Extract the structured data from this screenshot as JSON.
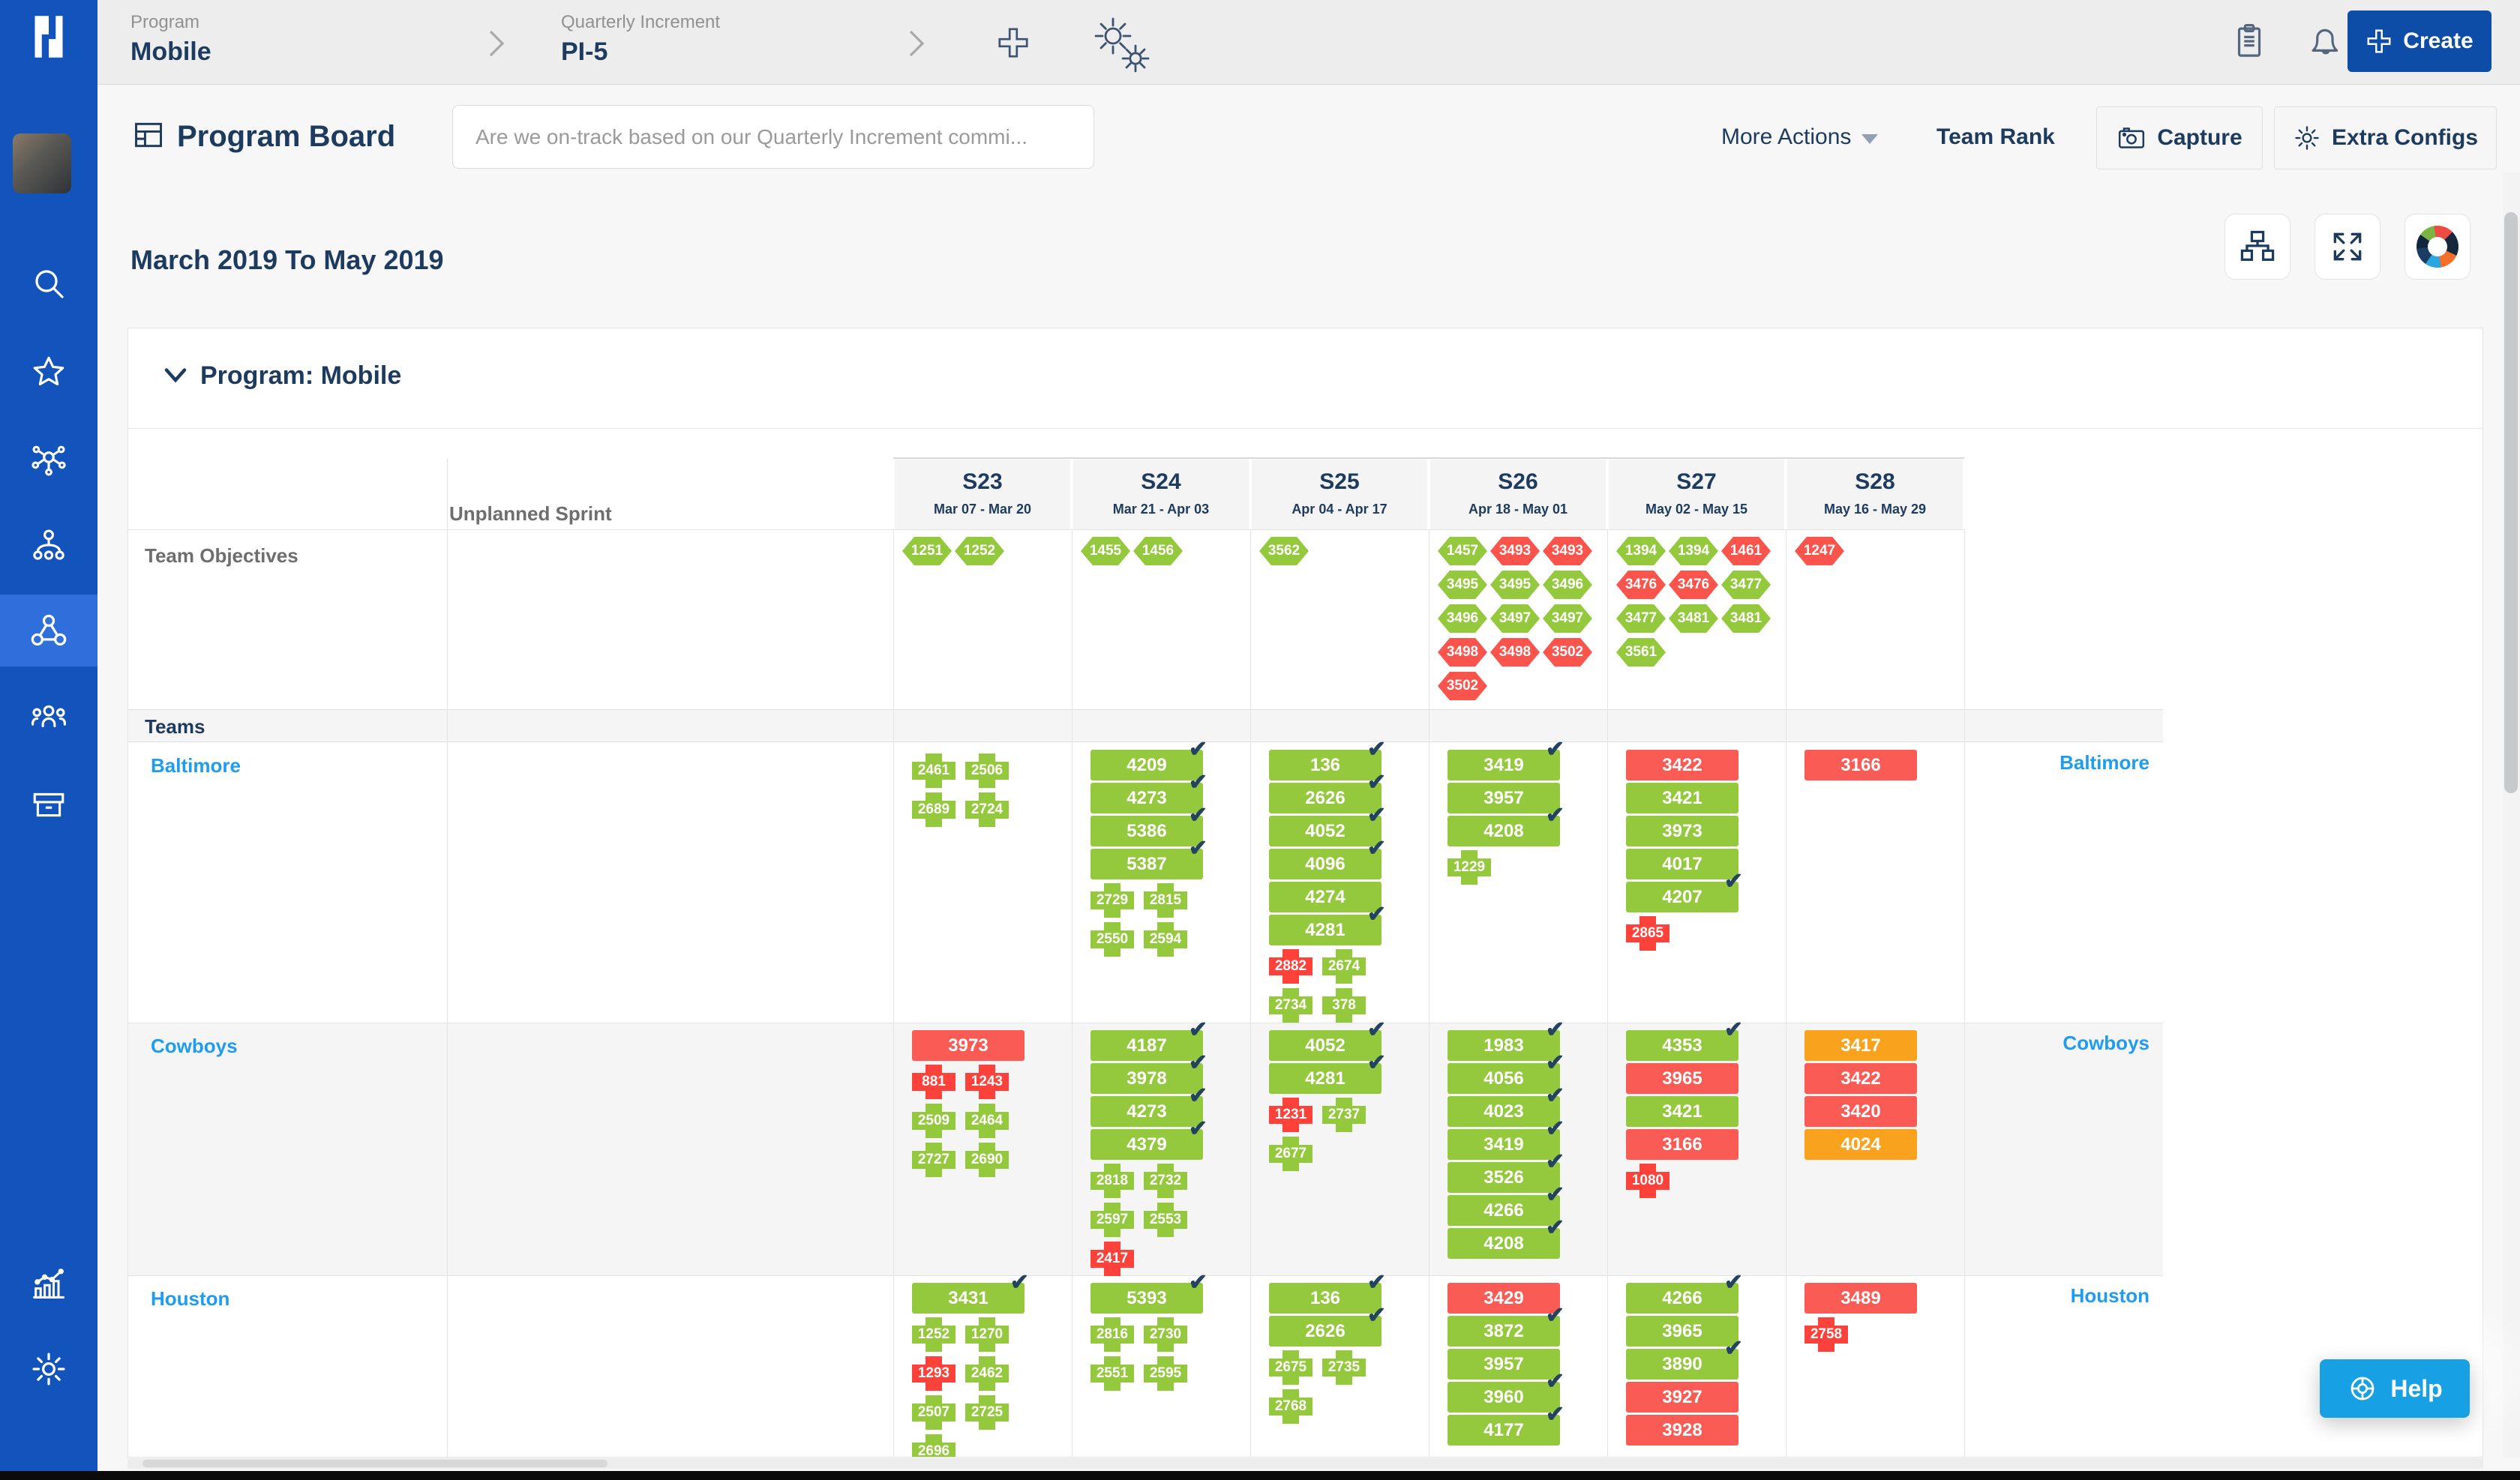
{
  "topbar": {
    "breadcrumbs": [
      {
        "label": "Program",
        "value": "Mobile"
      },
      {
        "label": "Quarterly Increment",
        "value": "PI-5"
      }
    ],
    "create_label": "Create"
  },
  "toolbar": {
    "title": "Program Board",
    "search_value": "Are we on-track based on our Quarterly Increment commi...",
    "more_actions_label": "More Actions",
    "team_rank_label": "Team Rank",
    "capture_label": "Capture",
    "extra_configs_label": "Extra Configs"
  },
  "board": {
    "date_range": "March 2019 To May 2019",
    "section_label": "Program: Mobile",
    "unplanned_sprint_label": "Unplanned Sprint",
    "team_objectives_label": "Team Objectives",
    "teams_label": "Teams",
    "sprints": [
      {
        "name": "S23",
        "dates": "Mar 07 - Mar 20"
      },
      {
        "name": "S24",
        "dates": "Mar 21 - Apr 03"
      },
      {
        "name": "S25",
        "dates": "Apr 04 - Apr 17"
      },
      {
        "name": "S26",
        "dates": "Apr 18 - May 01"
      },
      {
        "name": "S27",
        "dates": "May 02 - May 15"
      },
      {
        "name": "S28",
        "dates": "May 16 - May 29"
      }
    ],
    "objectives": [
      [
        [
          "1251",
          "green"
        ],
        [
          "1252",
          "green"
        ]
      ],
      [
        [
          "1455",
          "green"
        ],
        [
          "1456",
          "green"
        ]
      ],
      [
        [
          "3562",
          "green"
        ]
      ],
      [
        [
          "1457",
          "green"
        ],
        [
          "3493",
          "red"
        ],
        [
          "3493",
          "red"
        ],
        [
          "3495",
          "green"
        ],
        [
          "3495",
          "green"
        ],
        [
          "3496",
          "green"
        ],
        [
          "3496",
          "green"
        ],
        [
          "3497",
          "green"
        ],
        [
          "3497",
          "green"
        ],
        [
          "3498",
          "red"
        ],
        [
          "3498",
          "red"
        ],
        [
          "3502",
          "red"
        ],
        [
          "3502",
          "red"
        ]
      ],
      [
        [
          "1394",
          "green"
        ],
        [
          "1394",
          "green"
        ],
        [
          "1461",
          "red"
        ],
        [
          "3476",
          "red"
        ],
        [
          "3476",
          "red"
        ],
        [
          "3477",
          "green"
        ],
        [
          "3477",
          "green"
        ],
        [
          "3481",
          "green"
        ],
        [
          "3481",
          "green"
        ],
        [
          "3561",
          "green"
        ]
      ],
      [
        [
          "1247",
          "red"
        ]
      ]
    ],
    "teams": [
      {
        "name": "Baltimore",
        "cells": [
          {
            "features": [],
            "stories": [
              [
                "2461",
                "green"
              ],
              [
                "2506",
                "green"
              ],
              [
                "2689",
                "green"
              ],
              [
                "2724",
                "green"
              ]
            ]
          },
          {
            "features": [
              [
                "4209",
                "green",
                true
              ],
              [
                "4273",
                "green",
                true
              ],
              [
                "5386",
                "green",
                true
              ],
              [
                "5387",
                "green",
                true
              ]
            ],
            "stories": [
              [
                "2729",
                "green"
              ],
              [
                "2815",
                "green"
              ],
              [
                "2550",
                "green"
              ],
              [
                "2594",
                "green"
              ]
            ]
          },
          {
            "features": [
              [
                "136",
                "green",
                true
              ],
              [
                "2626",
                "green",
                true
              ],
              [
                "4052",
                "green",
                true
              ],
              [
                "4096",
                "green",
                true
              ],
              [
                "4274",
                "green",
                false
              ],
              [
                "4281",
                "green",
                true
              ]
            ],
            "stories": [
              [
                "2882",
                "red"
              ],
              [
                "2674",
                "green"
              ],
              [
                "2734",
                "green"
              ],
              [
                "378",
                "green"
              ]
            ]
          },
          {
            "features": [
              [
                "3419",
                "green",
                true
              ],
              [
                "3957",
                "green",
                false
              ],
              [
                "4208",
                "green",
                true
              ]
            ],
            "stories": [
              [
                "1229",
                "green"
              ]
            ]
          },
          {
            "features": [
              [
                "3422",
                "red",
                false
              ],
              [
                "3421",
                "green",
                false
              ],
              [
                "3973",
                "green",
                false
              ],
              [
                "4017",
                "green",
                false
              ],
              [
                "4207",
                "green",
                true
              ]
            ],
            "stories": [
              [
                "2865",
                "red"
              ]
            ]
          },
          {
            "features": [
              [
                "3166",
                "red",
                false
              ]
            ],
            "stories": []
          }
        ]
      },
      {
        "name": "Cowboys",
        "cells": [
          {
            "features": [
              [
                "3973",
                "red",
                false
              ]
            ],
            "stories": [
              [
                "881",
                "red"
              ],
              [
                "1243",
                "red"
              ],
              [
                "2509",
                "green"
              ],
              [
                "2464",
                "green"
              ],
              [
                "2727",
                "green"
              ],
              [
                "2690",
                "green"
              ]
            ]
          },
          {
            "features": [
              [
                "4187",
                "green",
                true
              ],
              [
                "3978",
                "green",
                true
              ],
              [
                "4273",
                "green",
                true
              ],
              [
                "4379",
                "green",
                true
              ]
            ],
            "stories": [
              [
                "2818",
                "green"
              ],
              [
                "2732",
                "green"
              ],
              [
                "2597",
                "green"
              ],
              [
                "2553",
                "green"
              ],
              [
                "2417",
                "red"
              ]
            ]
          },
          {
            "features": [
              [
                "4052",
                "green",
                true
              ],
              [
                "4281",
                "green",
                true
              ]
            ],
            "stories": [
              [
                "1231",
                "red"
              ],
              [
                "2737",
                "green"
              ],
              [
                "2677",
                "green"
              ]
            ]
          },
          {
            "features": [
              [
                "1983",
                "green",
                true
              ],
              [
                "4056",
                "green",
                true
              ],
              [
                "4023",
                "green",
                true
              ],
              [
                "3419",
                "green",
                true
              ],
              [
                "3526",
                "green",
                true
              ],
              [
                "4266",
                "green",
                true
              ],
              [
                "4208",
                "green",
                true
              ]
            ],
            "stories": []
          },
          {
            "features": [
              [
                "4353",
                "green",
                true
              ],
              [
                "3965",
                "red",
                false
              ],
              [
                "3421",
                "green",
                false
              ],
              [
                "3166",
                "red",
                false
              ]
            ],
            "stories": [
              [
                "1080",
                "red"
              ]
            ]
          },
          {
            "features": [
              [
                "3417",
                "orange",
                false
              ],
              [
                "3422",
                "red",
                false
              ],
              [
                "3420",
                "red",
                false
              ],
              [
                "4024",
                "orange",
                false
              ]
            ],
            "stories": []
          }
        ]
      },
      {
        "name": "Houston",
        "cells": [
          {
            "features": [
              [
                "3431",
                "green",
                true
              ]
            ],
            "stories": [
              [
                "1252",
                "green"
              ],
              [
                "1270",
                "green"
              ],
              [
                "1293",
                "red"
              ],
              [
                "2462",
                "green"
              ],
              [
                "2507",
                "green"
              ],
              [
                "2725",
                "green"
              ],
              [
                "2696",
                "green"
              ]
            ]
          },
          {
            "features": [
              [
                "5393",
                "green",
                true
              ]
            ],
            "stories": [
              [
                "2816",
                "green"
              ],
              [
                "2730",
                "green"
              ],
              [
                "2551",
                "green"
              ],
              [
                "2595",
                "green"
              ]
            ]
          },
          {
            "features": [
              [
                "136",
                "green",
                true
              ],
              [
                "2626",
                "green",
                true
              ]
            ],
            "stories": [
              [
                "2675",
                "green"
              ],
              [
                "2735",
                "green"
              ],
              [
                "2768",
                "green"
              ]
            ]
          },
          {
            "features": [
              [
                "3429",
                "red",
                false
              ],
              [
                "3872",
                "green",
                true
              ],
              [
                "3957",
                "green",
                false
              ],
              [
                "3960",
                "green",
                true
              ],
              [
                "4177",
                "green",
                true
              ]
            ],
            "stories": []
          },
          {
            "features": [
              [
                "4266",
                "green",
                true
              ],
              [
                "3965",
                "green",
                false
              ],
              [
                "3890",
                "green",
                true
              ],
              [
                "3927",
                "red",
                false
              ],
              [
                "3928",
                "red",
                false
              ]
            ],
            "stories": []
          },
          {
            "features": [
              [
                "3489",
                "red",
                false
              ]
            ],
            "stories": [
              [
                "2758",
                "red"
              ]
            ]
          }
        ]
      }
    ]
  },
  "help_label": "Help",
  "icons": {
    "sidebar": [
      "search",
      "star",
      "network",
      "hierarchy",
      "program-board",
      "people",
      "archive",
      "analytics",
      "settings"
    ],
    "topbar": [
      "plus",
      "gears",
      "clipboard",
      "bell",
      "search",
      "create-plus"
    ],
    "board_header": [
      "sitemap",
      "expand",
      "color-wheel"
    ]
  },
  "colors": {
    "green": "#95c93d",
    "red": "#fb5b55",
    "bright_red": "#fc423b",
    "orange": "#f9a21d",
    "navy": "#1d3a5f",
    "link_blue": "#1f9ced",
    "sidebar_blue": "#1254bc",
    "create_blue": "#0d4da8",
    "help_blue": "#18a0e4"
  }
}
